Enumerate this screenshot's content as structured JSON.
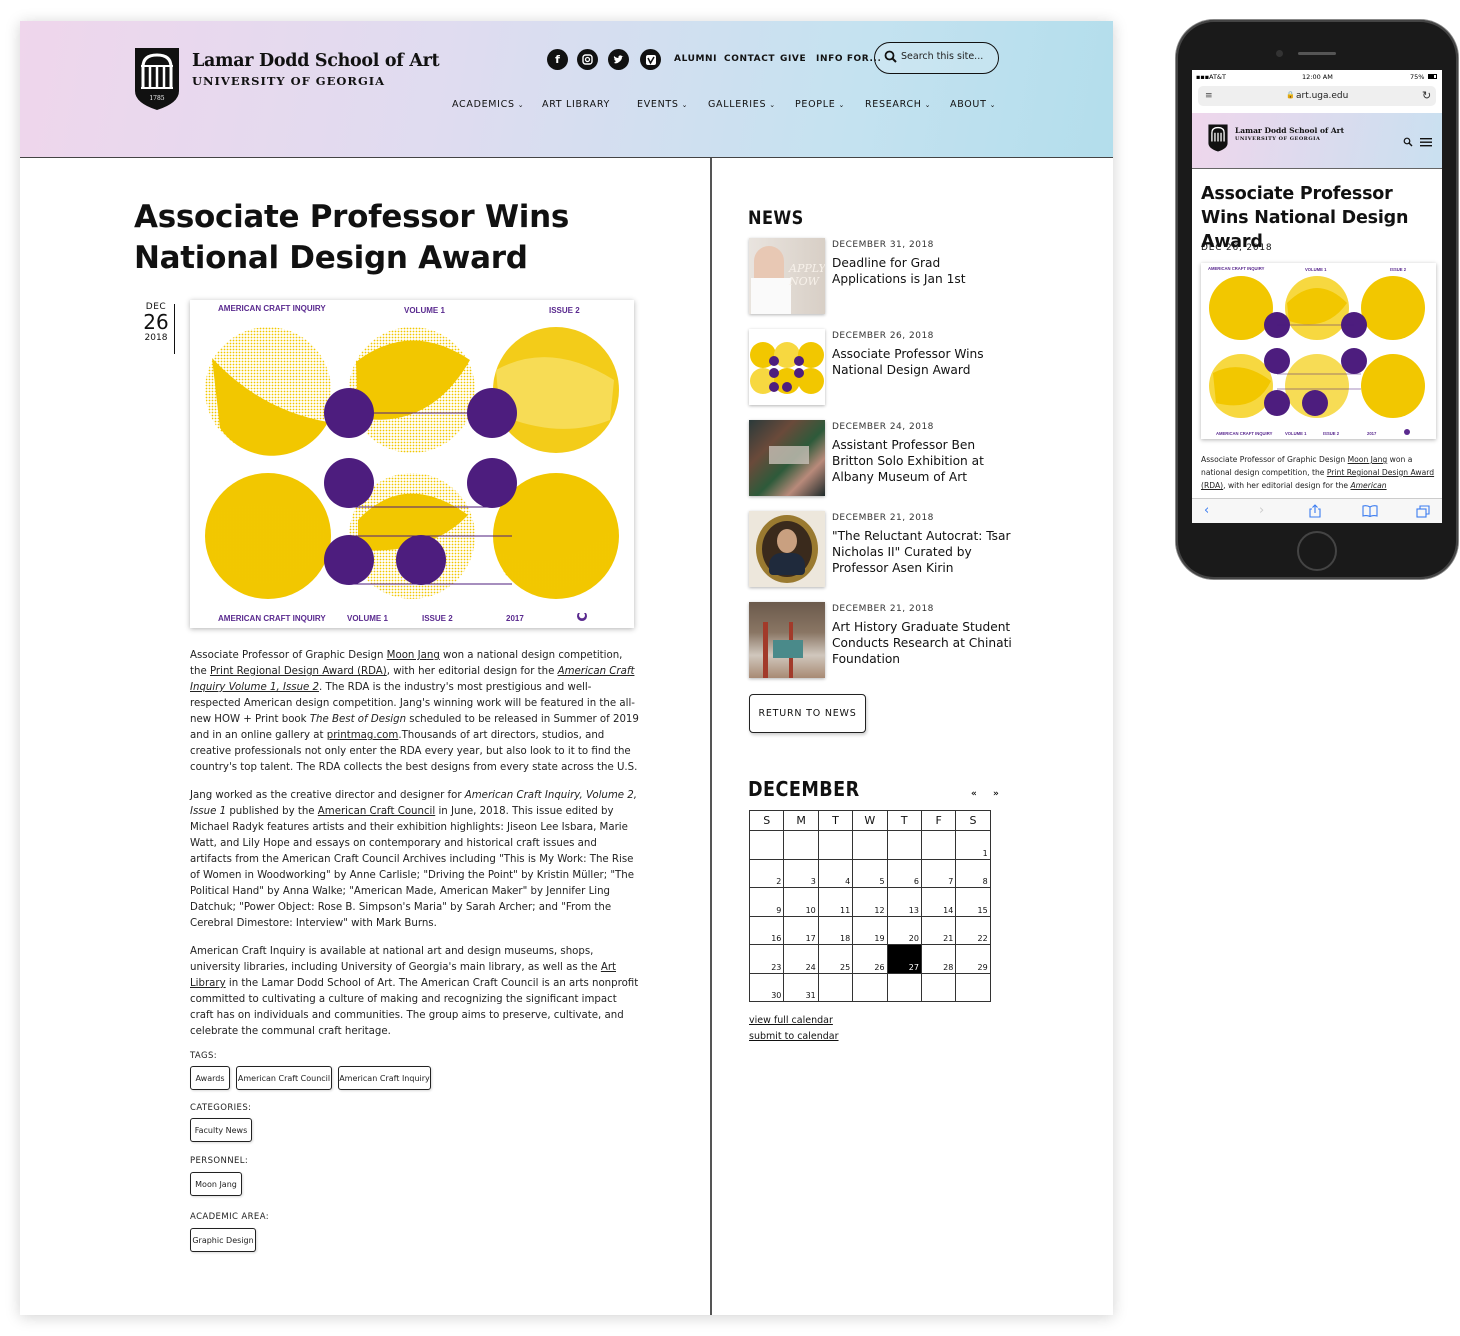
{
  "site": {
    "school_name": "Lamar Dodd School of Art",
    "university": "UNIVERSITY OF GEORGIA",
    "shield_year": "1785",
    "social_icons": [
      "facebook-icon",
      "instagram-icon",
      "twitter-icon",
      "vimeo-icon"
    ],
    "utility_links": [
      "ALUMNI",
      "CONTACT",
      "GIVE",
      "INFO FOR..."
    ],
    "search_placeholder": "Search this site...",
    "nav": [
      "ACADEMICS",
      "ART LIBRARY",
      "EVENTS",
      "GALLERIES",
      "PEOPLE",
      "RESEARCH",
      "ABOUT"
    ],
    "dropdown_symbol": "⌄"
  },
  "article": {
    "title": "Associate Professor Wins National Design Award",
    "date": {
      "month": "DEC",
      "day": "26",
      "year": "2018"
    },
    "poster": {
      "top": [
        "AMERICAN CRAFT INQUIRY",
        "VOLUME 1",
        "ISSUE 2"
      ],
      "bottom": [
        "AMERICAN CRAFT INQUIRY",
        "VOLUME 1",
        "ISSUE 2",
        "2017"
      ],
      "colors": {
        "yellow": "#f2c700",
        "purple": "#4d1d7e",
        "ink": "#5a2a8f"
      }
    },
    "p1": [
      "Associate Professor of Graphic Design ",
      "Moon Jang",
      " won a national design competition, the ",
      "Print Regional Design Award (RDA)",
      ", with her editorial design for the ",
      "American Craft Inquiry Volume 1, Issue 2",
      ". The RDA is the industry's most prestigious and well-respected American design competition. Jang's winning work will be featured in the all-new HOW + Print book ",
      "The Best of Design",
      " scheduled to be released in Summer of 2019 and in an online gallery at ",
      "printmag.com",
      ".Thousands of art directors, studios, and creative professionals not only enter the RDA every year, but also look to it to find the country's top talent. The RDA collects the best designs from every state across the U.S."
    ],
    "p2": [
      "Jang worked as the creative director and designer for ",
      "American Craft Inquiry, Volume 2, Issue 1",
      " published by the ",
      "American Craft Council",
      " in June, 2018. This issue edited by Michael Radyk features artists and their exhibition highlights: Jiseon Lee Isbara, Marie Watt, and Lily Hope and essays on contemporary and historical craft issues and artifacts from the American Craft Council Archives including \"This is My Work: The Rise of Women in Woodworking\" by Anne Carlisle; \"Driving the Point\" by Kristin Müller; \"The Political Hand\" by Anna Walke; \"American Made, American Maker\" by Jennifer Ling Datchuk; \"Power Object: Rose B. Simpson's Maria\" by Sarah Archer; and \"From the Cerebral Dimestore: Interview\" with Mark Burns."
    ],
    "p3": [
      "American Craft Inquiry is available at national art and design museums, shops, university libraries, including University of Georgia's main library, as well as the ",
      "Art Library",
      " in the Lamar Dodd School of Art. The American Craft Council is an arts nonprofit committed to cultivating a culture of making and recognizing the significant impact craft has on individuals and communities. The group aims to preserve, cultivate, and celebrate the communal craft heritage."
    ],
    "tags_label": "TAGS:",
    "tags": [
      "Awards",
      "American Craft Council",
      "American Craft Inquiry"
    ],
    "categories_label": "CATEGORIES:",
    "categories": [
      "Faculty News"
    ],
    "personnel_label": "PERSONNEL:",
    "personnel": [
      "Moon Jang"
    ],
    "academic_label": "ACADEMIC AREA:",
    "academic": [
      "Graphic Design"
    ]
  },
  "news": {
    "heading": "NEWS",
    "items": [
      {
        "date": "DECEMBER 31, 2018",
        "title": "Deadline for Grad Applications is Jan 1st",
        "thumb_text": "APPLY NOW"
      },
      {
        "date": "DECEMBER 26, 2018",
        "title": "Associate Professor Wins National Design Award"
      },
      {
        "date": "DECEMBER 24, 2018",
        "title": "Assistant Professor Ben Britton Solo Exhibition at Albany Museum of Art"
      },
      {
        "date": "DECEMBER 21, 2018",
        "title": "\"The Reluctant Autocrat: Tsar Nicholas II\" Curated by Professor Asen Kirin"
      },
      {
        "date": "DECEMBER 21, 2018",
        "title": "Art History Graduate Student Conducts Research at Chinati Foundation"
      }
    ],
    "return_label": "RETURN TO NEWS"
  },
  "calendar": {
    "month": "DECEMBER",
    "prev": "«",
    "next": "»",
    "weekdays": [
      "S",
      "M",
      "T",
      "W",
      "T",
      "F",
      "S"
    ],
    "weeks": [
      [
        "",
        "",
        "",
        "",
        "",
        "",
        "1"
      ],
      [
        "2",
        "3",
        "4",
        "5",
        "6",
        "7",
        "8"
      ],
      [
        "9",
        "10",
        "11",
        "12",
        "13",
        "14",
        "15"
      ],
      [
        "16",
        "17",
        "18",
        "19",
        "20",
        "21",
        "22"
      ],
      [
        "23",
        "24",
        "25",
        "26",
        "27",
        "28",
        "29"
      ],
      [
        "30",
        "31",
        "",
        "",
        "",
        "",
        ""
      ]
    ],
    "today": "27",
    "view_link": "view full calendar",
    "submit_link": "submit to calendar"
  },
  "phone": {
    "carrier": "AT&T",
    "time": "12:00 AM",
    "battery": "75%",
    "url": "art.uga.edu",
    "school_name": "Lamar Dodd School of Art",
    "university": "UNIVERSITY OF GEORGIA",
    "title": "Associate Professor Wins National Design Award",
    "date": "DEC 26, 2018",
    "poster_top": [
      "AMERICAN CRAFT INQUIRY",
      "VOLUME 1",
      "ISSUE 2"
    ],
    "poster_bottom": [
      "AMERICAN CRAFT INQUIRY",
      "VOLUME 1",
      "ISSUE 2",
      "2017"
    ],
    "body": [
      "Associate Professor of Graphic Design ",
      "Moon Jang",
      " won a national design competition, the ",
      "Print Regional Design Award (RDA)",
      ", with her editorial design for the ",
      "American"
    ],
    "toolbar_icons": [
      "back-icon",
      "forward-icon",
      "share-icon",
      "bookmarks-icon",
      "tabs-icon"
    ]
  }
}
